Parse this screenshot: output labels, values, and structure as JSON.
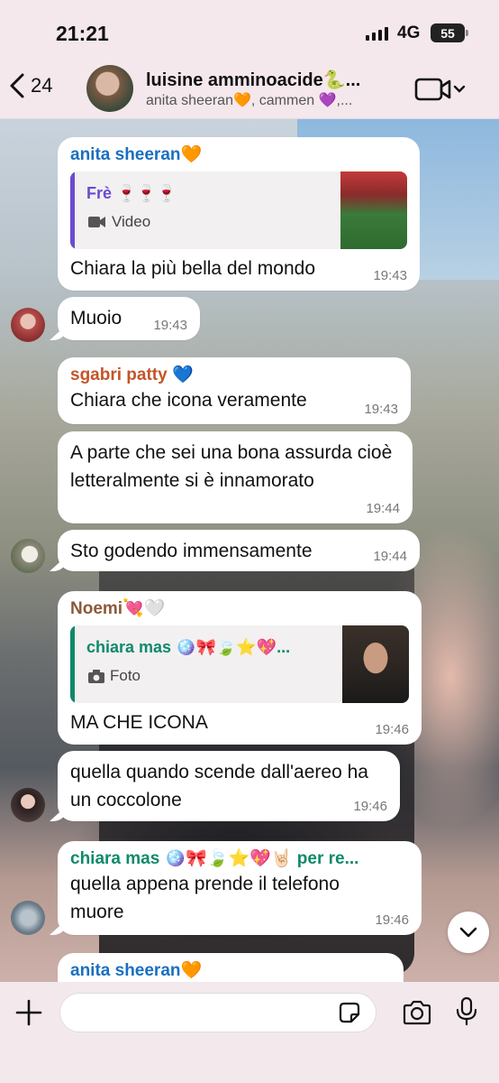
{
  "status_bar": {
    "time": "21:21",
    "network": "4G",
    "battery": "55"
  },
  "header": {
    "back_count": "24",
    "group_name": "luisine amminoacide🐍...",
    "participants": "anita sheeran🧡, cammen 💜,..."
  },
  "messages": [
    {
      "sender": "anita sheeran🧡",
      "sender_color": "#1a6fc2",
      "quote": {
        "name": "Frè 🍷🍷🍷",
        "name_color": "#6b4bd0",
        "bar_color": "#6b4bd0",
        "type_icon": "video-icon",
        "type_label": "Video"
      },
      "text": "Chiara la più bella del mondo",
      "time": "19:43"
    },
    {
      "text": "Muoio",
      "time": "19:43"
    },
    {
      "sender": "sgabri patty 💙",
      "sender_color": "#c4552a",
      "text": "Chiara che icona veramente",
      "time": "19:43"
    },
    {
      "text": "A parte che sei una bona assurda cioè letteralmente si è innamorato",
      "time": "19:44"
    },
    {
      "text": "Sto godendo immensamente",
      "time": "19:44"
    },
    {
      "sender": "Noemi💘🤍",
      "sender_color": "#8a5a3a",
      "quote": {
        "name": "chiara mas 🪩🎀🍃⭐💖...",
        "name_color": "#0f8a6a",
        "bar_color": "#0f8a6a",
        "type_icon": "camera-icon",
        "type_label": "Foto"
      },
      "text": "MA CHE ICONA",
      "time": "19:46"
    },
    {
      "text": "quella quando scende dall'aereo ha un coccolone",
      "time": "19:46"
    },
    {
      "sender": "chiara mas 🪩🎀🍃⭐💖🤘🏻 per re...",
      "sender_color": "#0f8a6a",
      "text": "quella appena prende il telefono muore",
      "time": "19:46"
    },
    {
      "sender": "anita sheeran🧡",
      "sender_color": "#1a6fc2"
    }
  ],
  "input": {
    "placeholder": ""
  }
}
